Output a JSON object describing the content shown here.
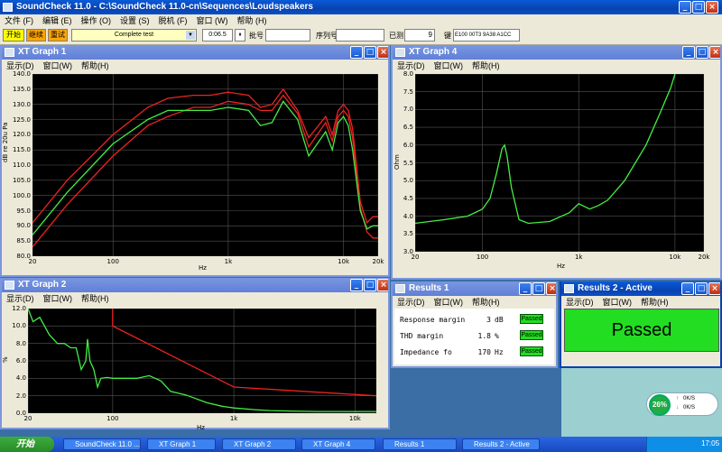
{
  "app": {
    "title": "SoundCheck 11.0 - C:\\SoundCheck 11.0-cn\\Sequences\\Loudspeakers",
    "menu": [
      "文件 (F)",
      "编辑 (E)",
      "操作 (O)",
      "设置 (S)",
      "脱机 (F)",
      "窗口 (W)",
      "帮助 (H)"
    ]
  },
  "toolbar": {
    "start": "开始",
    "continue": "继续",
    "retry": "重试",
    "sequence": "Complete test",
    "time": "0:06.5",
    "pause": "⏸",
    "batch_label": "批号",
    "serial_label": "序列号",
    "tested_label": "已测",
    "tested_value": "9",
    "key_label": "键",
    "key_value": "E100 00T3 9A38 A1CC"
  },
  "windows": {
    "xt1": {
      "title": "XT Graph 1",
      "menu": [
        "显示(D)",
        "窗口(W)",
        "帮助(H)"
      ],
      "ylabel": "dB re 20u Pa",
      "xlabel": "Hz",
      "yticks": [
        "140.0",
        "135.0",
        "130.0",
        "125.0",
        "120.0",
        "115.0",
        "110.0",
        "105.0",
        "100.0",
        "95.0",
        "90.0",
        "85.0",
        "80.0"
      ],
      "xticks": [
        "20",
        "100",
        "1k",
        "10k",
        "20k"
      ]
    },
    "xt4": {
      "title": "XT Graph 4",
      "menu": [
        "显示(D)",
        "窗口(W)",
        "帮助(H)"
      ],
      "ylabel": "Ohm",
      "xlabel": "Hz",
      "yticks": [
        "8.0",
        "7.5",
        "7.0",
        "6.5",
        "6.0",
        "5.5",
        "5.0",
        "4.5",
        "4.0",
        "3.5",
        "3.0"
      ],
      "xticks": [
        "20",
        "100",
        "1k",
        "10k",
        "20k"
      ]
    },
    "xt2": {
      "title": "XT Graph 2",
      "menu": [
        "显示(D)",
        "窗口(W)",
        "帮助(H)"
      ],
      "ylabel": "%",
      "xlabel": "Hz",
      "yticks": [
        "12.0",
        "10.0",
        "8.0",
        "6.0",
        "4.0",
        "2.0",
        "0.0"
      ],
      "xticks": [
        "20",
        "100",
        "1k",
        "10k"
      ]
    },
    "results1": {
      "title": "Results 1",
      "menu": [
        "显示(D)",
        "窗口(W)",
        "帮助(H)"
      ],
      "rows": [
        {
          "label": "Response margin",
          "value": "3",
          "unit": "dB",
          "status": "Passed"
        },
        {
          "label": "THD margin",
          "value": "1.8",
          "unit": "%",
          "status": "Passed"
        },
        {
          "label": "Impedance fo",
          "value": "170",
          "unit": "Hz",
          "status": "Passed"
        }
      ]
    },
    "results2": {
      "title": "Results 2 - Active",
      "menu": [
        "显示(D)",
        "窗口(W)",
        "帮助(H)"
      ],
      "verdict": "Passed",
      "verdict_color": "#22dd22"
    }
  },
  "desktop": {
    "gauge": "26%",
    "net_up": "0K/S",
    "net_down": "0K/S"
  },
  "taskbar": {
    "start": "开始",
    "tasks": [
      "SoundCheck 11.0 ...",
      "XT Graph 1",
      "XT Graph 2",
      "XT Graph 4",
      "Results 1",
      "Results 2 - Active"
    ],
    "clock": "17:05"
  },
  "chart_data": [
    {
      "type": "line",
      "window": "XT Graph 1",
      "xscale": "log",
      "xlim": [
        20,
        20000
      ],
      "ylim": [
        80,
        140
      ],
      "series": [
        {
          "color": "#ee2222",
          "x": [
            20,
            40,
            100,
            200,
            300,
            500,
            700,
            1000,
            1500,
            1900,
            2400,
            3000,
            4000,
            5000,
            7000,
            8000,
            9000,
            10000,
            11000,
            12000,
            14000,
            16000,
            18000,
            20000
          ],
          "y": [
            83,
            97,
            113,
            123,
            126,
            129,
            129,
            131,
            130,
            128,
            128,
            133,
            127,
            116,
            124,
            118,
            126,
            128,
            126,
            119,
            96,
            88,
            86,
            86
          ]
        },
        {
          "color": "#44ee44",
          "x": [
            20,
            40,
            100,
            200,
            300,
            500,
            700,
            1000,
            1500,
            1900,
            2400,
            3000,
            4000,
            5000,
            7000,
            8000,
            9000,
            10000,
            11000,
            12000,
            14000,
            16000,
            18000,
            20000
          ],
          "y": [
            87,
            101,
            117,
            125,
            128,
            128,
            128,
            129,
            128,
            123,
            124,
            131,
            125,
            113,
            121,
            115,
            124,
            126,
            123,
            115,
            95,
            89,
            90,
            90
          ]
        },
        {
          "color": "#ee2222",
          "x": [
            20,
            40,
            100,
            200,
            300,
            500,
            700,
            1000,
            1500,
            1900,
            2400,
            3000,
            4000,
            5000,
            7000,
            8000,
            9000,
            10000,
            11000,
            12000,
            14000,
            16000,
            18000,
            20000
          ],
          "y": [
            91,
            105,
            120,
            129,
            132,
            133,
            133,
            134,
            133,
            129,
            130,
            135,
            128,
            119,
            126,
            120,
            128,
            130,
            128,
            122,
            98,
            91,
            93,
            93
          ]
        }
      ]
    },
    {
      "type": "line",
      "window": "XT Graph 4",
      "xscale": "log",
      "xlim": [
        20,
        20000
      ],
      "ylim": [
        3,
        8
      ],
      "series": [
        {
          "color": "#44ee44",
          "x": [
            20,
            40,
            70,
            100,
            120,
            140,
            160,
            170,
            180,
            200,
            240,
            300,
            500,
            800,
            1000,
            1300,
            1600,
            2000,
            3000,
            5000,
            7000,
            9000,
            10000
          ],
          "y": [
            3.8,
            3.9,
            4.0,
            4.2,
            4.5,
            5.2,
            5.9,
            6.0,
            5.7,
            4.8,
            3.9,
            3.8,
            3.85,
            4.1,
            4.35,
            4.2,
            4.3,
            4.45,
            5.0,
            6.0,
            6.9,
            7.6,
            8.0
          ]
        }
      ]
    },
    {
      "type": "line",
      "window": "XT Graph 2",
      "xscale": "log",
      "xlim": [
        20,
        15000
      ],
      "ylim": [
        0,
        12
      ],
      "series": [
        {
          "color": "#44ee44",
          "x": [
            20,
            22,
            25,
            30,
            35,
            40,
            45,
            50,
            55,
            60,
            62,
            65,
            70,
            75,
            80,
            90,
            100,
            130,
            160,
            200,
            250,
            300,
            400,
            600,
            800,
            1000,
            1500,
            2000,
            3000,
            5000,
            8000,
            15000
          ],
          "y": [
            12,
            10.5,
            11,
            9,
            8,
            8,
            7.5,
            7.5,
            5,
            6,
            8.5,
            6,
            5,
            3,
            4,
            4.1,
            4,
            4,
            4,
            4.3,
            3.7,
            2.5,
            2.1,
            1.2,
            0.8,
            0.6,
            0.4,
            0.3,
            0.25,
            0.2,
            0.2,
            0.2
          ]
        },
        {
          "color": "#ee2222",
          "x": [
            100,
            100,
            1000,
            15000
          ],
          "y": [
            12,
            10,
            3,
            2
          ]
        }
      ]
    }
  ]
}
